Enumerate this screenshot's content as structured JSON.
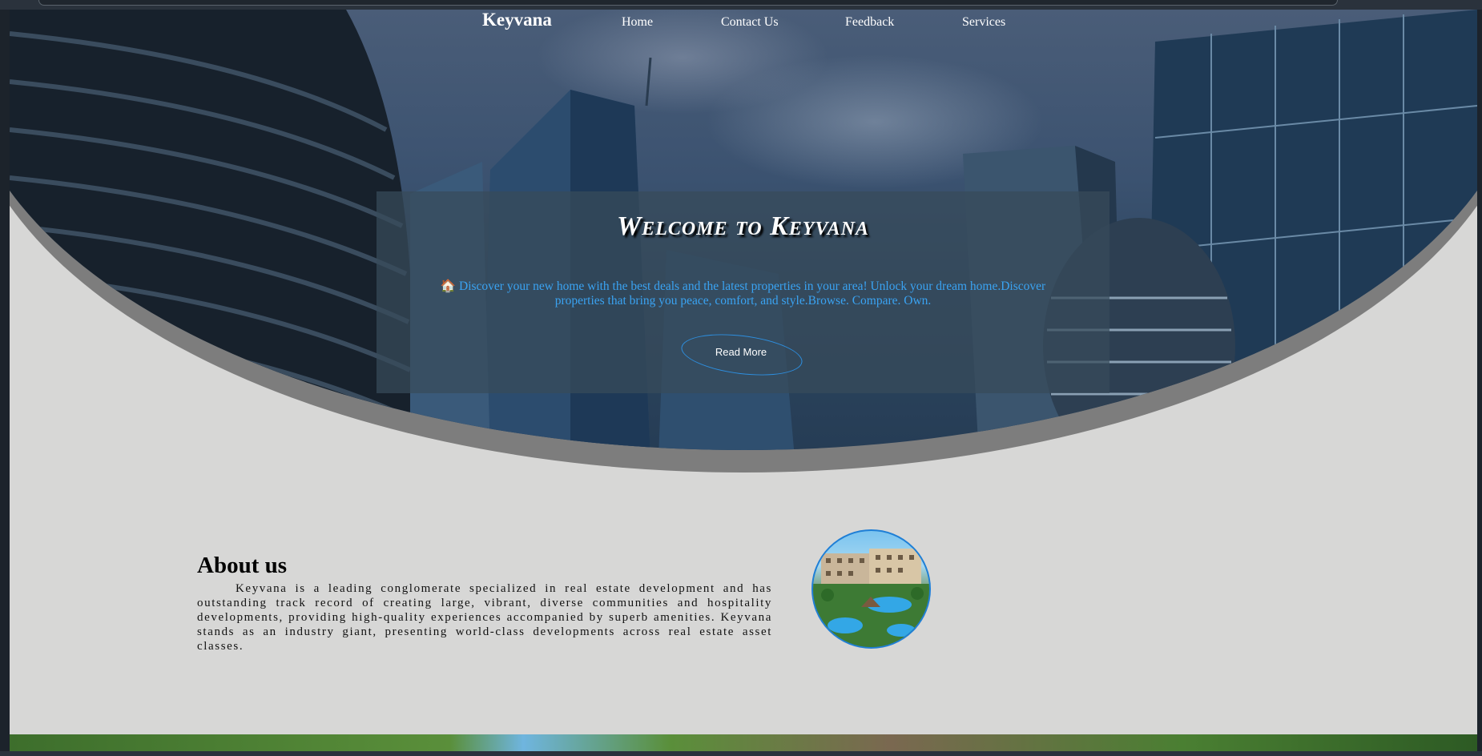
{
  "nav": {
    "brand": "Keyvana",
    "links": [
      "Home",
      "Contact Us",
      "Feedback",
      "Services"
    ]
  },
  "hero": {
    "title": "Welcome to Keyvana",
    "text": "🏠 Discover your new home with the best deals and the latest properties in your area! Unlock your dream home.Discover properties that bring you peace, comfort, and style.Browse. Compare. Own.",
    "button_label": "Read More"
  },
  "about": {
    "title": "About us",
    "text": "Keyvana is a leading conglomerate specialized in real estate development and has outstanding track record of creating large, vibrant, diverse communities and hospitality developments, providing high-quality experiences accompanied by superb amenities. Keyvana stands as an industry giant, presenting world-class developments across real estate asset classes."
  },
  "colors": {
    "accent": "#3aa3f2",
    "page_bg": "#d7d7d6",
    "curve_shadow": "#7d7d7d"
  }
}
